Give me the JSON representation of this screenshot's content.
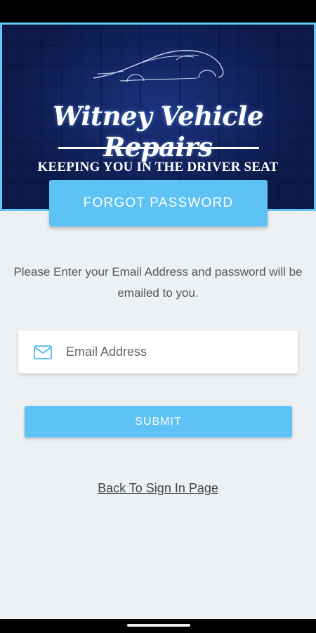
{
  "header": {
    "brand_title": "Witney Vehicle Repairs",
    "tagline": "KEEPING YOU IN THE DRIVER SEAT"
  },
  "page": {
    "banner_label": "FORGOT PASSWORD",
    "instructions": "Please Enter your Email Address and password will be emailed to you."
  },
  "form": {
    "email_placeholder": "Email Address",
    "email_value": "",
    "email_icon": "mail-icon",
    "submit_label": "SUBMIT"
  },
  "footer": {
    "back_link_label": "Back To Sign In Page"
  },
  "colors": {
    "accent": "#5fc2f4",
    "hero_background": "#0c1a4a",
    "page_background": "#eef1f4"
  }
}
